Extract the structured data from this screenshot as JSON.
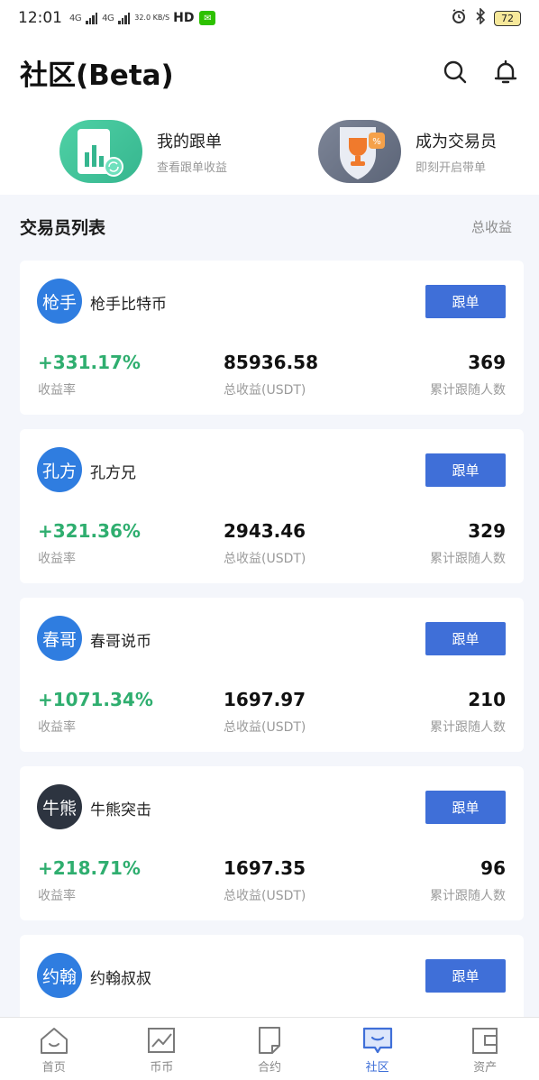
{
  "status_bar": {
    "time": "12:01",
    "signal1": "4G",
    "signal2": "4G",
    "speed": "32.0 KB/S",
    "hd": "HD",
    "battery": "72"
  },
  "header": {
    "title": "社区(Beta)"
  },
  "quick_entries": [
    {
      "title": "我的跟单",
      "subtitle": "查看跟单收益"
    },
    {
      "title": "成为交易员",
      "subtitle": "即刻开启带单"
    }
  ],
  "section": {
    "title": "交易员列表",
    "sort_label": "总收益"
  },
  "traders": [
    {
      "avatar_text": "枪手",
      "name": "枪手比特币",
      "follow_label": "跟单",
      "rate": "+331.17%",
      "rate_label": "收益率",
      "total": "85936.58",
      "total_label": "总收益(USDT)",
      "followers": "369",
      "followers_label": "累计跟随人数"
    },
    {
      "avatar_text": "孔方",
      "name": "孔方兄",
      "follow_label": "跟单",
      "rate": "+321.36%",
      "rate_label": "收益率",
      "total": "2943.46",
      "total_label": "总收益(USDT)",
      "followers": "329",
      "followers_label": "累计跟随人数"
    },
    {
      "avatar_text": "春哥",
      "name": "春哥说币",
      "follow_label": "跟单",
      "rate": "+1071.34%",
      "rate_label": "收益率",
      "total": "1697.97",
      "total_label": "总收益(USDT)",
      "followers": "210",
      "followers_label": "累计跟随人数"
    },
    {
      "avatar_text": "牛熊",
      "name": "牛熊突击",
      "follow_label": "跟单",
      "rate": "+218.71%",
      "rate_label": "收益率",
      "total": "1697.35",
      "total_label": "总收益(USDT)",
      "followers": "96",
      "followers_label": "累计跟随人数"
    },
    {
      "avatar_text": "约翰",
      "name": "约翰叔叔",
      "follow_label": "跟单"
    }
  ],
  "tabs": [
    {
      "label": "首页",
      "icon": "home-icon"
    },
    {
      "label": "币币",
      "icon": "chart-icon"
    },
    {
      "label": "合约",
      "icon": "contract-icon"
    },
    {
      "label": "社区",
      "icon": "community-icon",
      "active": true
    },
    {
      "label": "资产",
      "icon": "wallet-icon"
    }
  ],
  "colors": {
    "accent": "#3f6fd8",
    "positive": "#2fae6f",
    "background": "#f4f6fb"
  }
}
